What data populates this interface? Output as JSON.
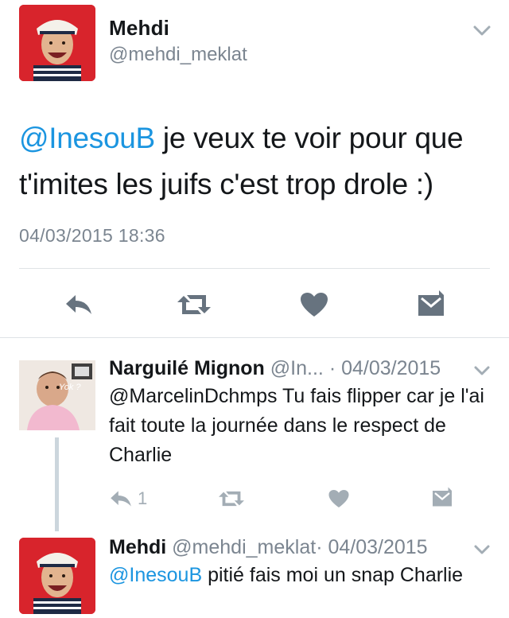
{
  "colors": {
    "mention_blue": "#1b95e0",
    "secondary_gray": "#7b8590",
    "icon_gray_dark": "#67737f",
    "icon_gray_light": "#a3adb5",
    "divider": "#dfe3e6",
    "avatar_red": "#d8242c"
  },
  "main_tweet": {
    "author_name": "Mehdi",
    "author_handle": "@mehdi_meklat",
    "mention": "@InesouB",
    "text_rest": " je veux te voir pour que t'imites les juifs c'est trop drole :)",
    "timestamp": "04/03/2015 18:36",
    "icons": {
      "more": "chevron-down-icon",
      "reply": "reply-icon",
      "retweet": "retweet-icon",
      "like": "heart-icon",
      "message": "envelope-icon"
    }
  },
  "replies": [
    {
      "author_name": "Narguilé Mignon",
      "author_handle": "@In...",
      "date": "· 04/03/2015",
      "text": "@MarcelinDchmps Tu fais flipper car je l'ai fait toute la journée dans le respect de Charlie",
      "reply_count": "1",
      "avatar_caption": "Yok ?"
    },
    {
      "author_name": "Mehdi",
      "author_handle": "@mehdi_meklat",
      "date": "· 04/03/2015",
      "mention": "@InesouB",
      "text_rest": " pitié fais moi un snap Charlie"
    }
  ]
}
